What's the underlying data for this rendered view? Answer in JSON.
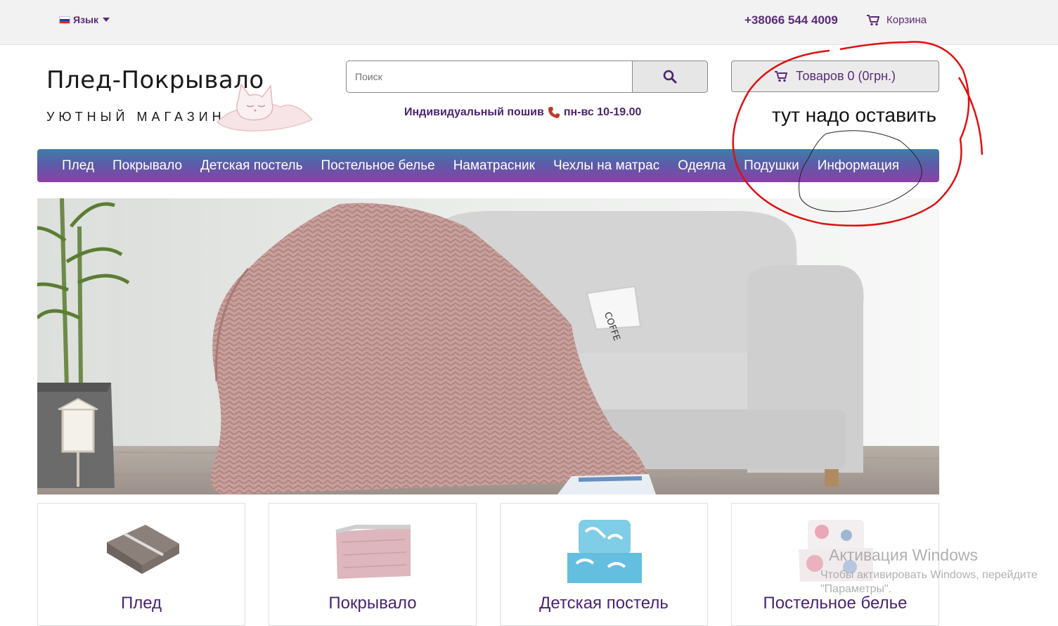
{
  "topbar": {
    "language_label": "Язык",
    "phone": "+38066 544 4009",
    "cart_label": "Корзина"
  },
  "header": {
    "logo_title": "Плед-Покрывало",
    "logo_subtitle": "УЮТНЫЙ МАГАЗИН",
    "search_placeholder": "Поиск",
    "tagline_text": "Индивидуальный пошив",
    "tagline_hours": "пн-вс 10-19.00",
    "cart_summary": "Товаров 0 (0грн.)"
  },
  "nav": {
    "items": [
      {
        "label": "Плед"
      },
      {
        "label": "Покрывало"
      },
      {
        "label": "Детская постель"
      },
      {
        "label": "Постельное белье"
      },
      {
        "label": "Наматрасник"
      },
      {
        "label": "Чехлы на матрас"
      },
      {
        "label": "Одеяла"
      },
      {
        "label": "Подушки"
      },
      {
        "label": "Информация"
      }
    ]
  },
  "hero": {
    "mug_text": "COFFE"
  },
  "categories": [
    {
      "label": "Плед"
    },
    {
      "label": "Покрывало"
    },
    {
      "label": "Детская постель"
    },
    {
      "label": "Постельное белье"
    }
  ],
  "annotation": {
    "text": "тут надо оставить"
  },
  "watermark": {
    "line1": "Активация Windows",
    "line2": "Чтобы активировать Windows, перейдите",
    "line3": "\"Параметры\"."
  },
  "colors": {
    "brand_purple": "#5b2b7a",
    "nav_gradient_top": "#3f7ea8",
    "nav_gradient_bottom": "#8a40a6",
    "annotation_red": "#e01010"
  }
}
